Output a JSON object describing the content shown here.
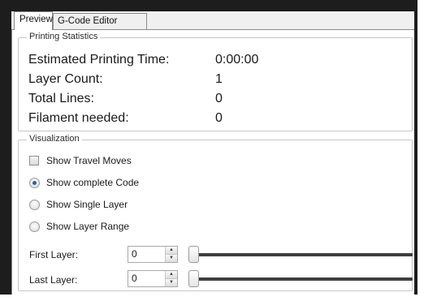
{
  "tabs": [
    {
      "label": "Preview",
      "active": true
    },
    {
      "label": "G-Code Editor",
      "active": false
    }
  ],
  "printing_statistics": {
    "title": "Printing Statistics",
    "rows": [
      {
        "label": "Estimated Printing Time:",
        "value": "0:00:00"
      },
      {
        "label": "Layer Count:",
        "value": "1"
      },
      {
        "label": "Total Lines:",
        "value": "0"
      },
      {
        "label": "Filament needed:",
        "value": "0"
      }
    ]
  },
  "visualization": {
    "title": "Visualization",
    "show_travel_moves": {
      "label": "Show Travel Moves",
      "checked": false
    },
    "modes": [
      {
        "label": "Show complete Code",
        "selected": true
      },
      {
        "label": "Show Single Layer",
        "selected": false
      },
      {
        "label": "Show Layer Range",
        "selected": false
      }
    ],
    "first_layer": {
      "label": "First Layer:",
      "value": "0",
      "slider_fraction": 0
    },
    "last_layer": {
      "label": "Last Layer:",
      "value": "0",
      "slider_fraction": 0
    }
  },
  "icons": {
    "spin_up": "spin-up-arrow-icon",
    "spin_down": "spin-down-arrow-icon"
  }
}
